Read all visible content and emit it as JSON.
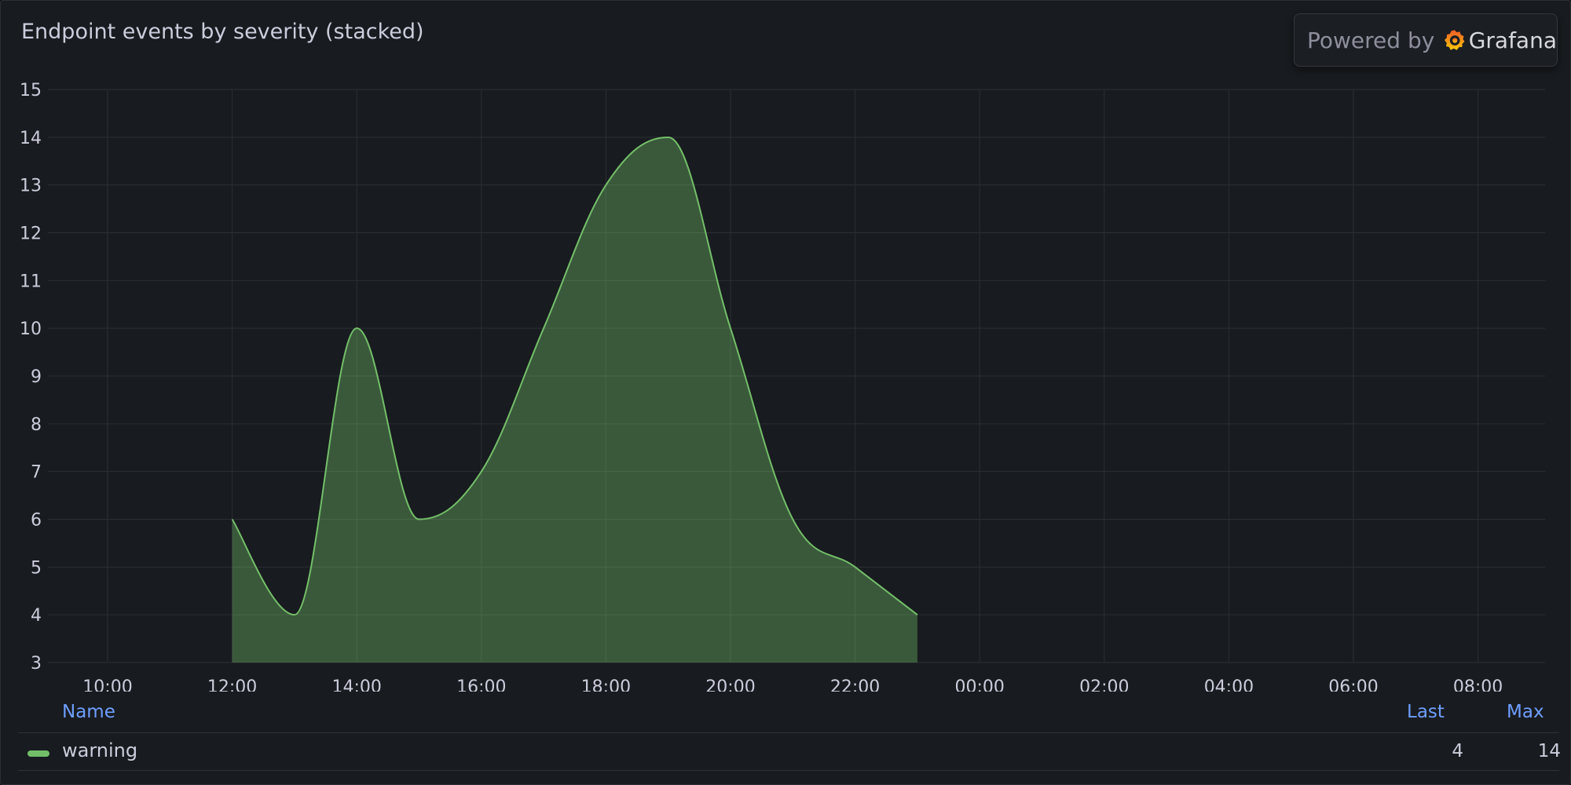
{
  "panel": {
    "title": "Endpoint events by severity (stacked)",
    "badge": {
      "powered_by": "Powered by",
      "brand": "Grafana"
    }
  },
  "legend": {
    "headers": {
      "name": "Name",
      "last": "Last",
      "max": "Max"
    },
    "rows": [
      {
        "name": "warning",
        "color": "#73bf69",
        "last": "4",
        "max": "14"
      }
    ]
  },
  "colors": {
    "background": "#181b1f",
    "grid": "#2c2f35",
    "text": "#ccccdc",
    "accent_blue": "#6e9fff",
    "series": "#73bf69"
  },
  "chart_data": {
    "type": "area",
    "title": "Endpoint events by severity (stacked)",
    "stacked": true,
    "grid": true,
    "legend_placement": "bottom",
    "xlabel": "",
    "ylabel": "",
    "x_ticks": [
      "10:00",
      "12:00",
      "14:00",
      "16:00",
      "18:00",
      "20:00",
      "22:00",
      "00:00",
      "02:00",
      "04:00",
      "06:00",
      "08:00"
    ],
    "y_ticks": [
      3,
      4,
      5,
      6,
      7,
      8,
      9,
      10,
      11,
      12,
      13,
      14,
      15
    ],
    "ylim": [
      3,
      15
    ],
    "xlim": [
      "09:08",
      "09:08 (next day)"
    ],
    "series": [
      {
        "name": "warning",
        "color": "#73bf69",
        "x": [
          "12:00",
          "13:00",
          "14:00",
          "15:00",
          "16:00",
          "17:00",
          "18:00",
          "19:00",
          "20:00",
          "21:00",
          "22:00",
          "23:00"
        ],
        "values": [
          6,
          4,
          10,
          6,
          7,
          10,
          13,
          14,
          10,
          6,
          5,
          4
        ]
      }
    ]
  }
}
